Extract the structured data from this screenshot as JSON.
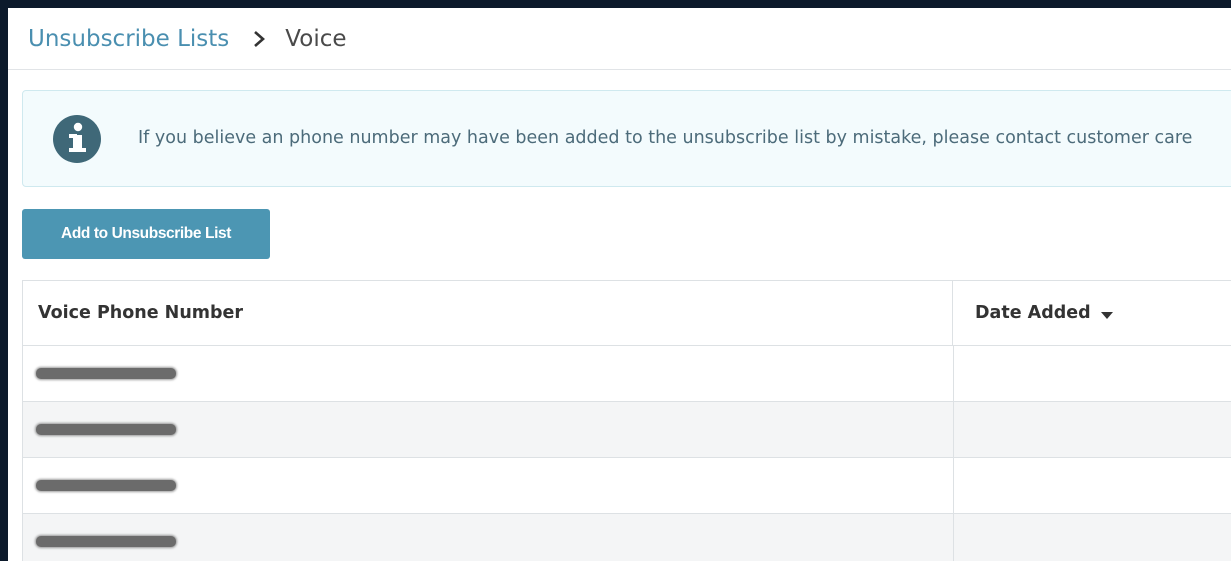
{
  "breadcrumb": {
    "parent": "Unsubscribe Lists",
    "current": "Voice"
  },
  "info": {
    "icon": "info-icon",
    "message": "If you believe an phone number may have been added to the unsubscribe list by mistake, please contact customer care"
  },
  "actions": {
    "add_label": "Add to Unsubscribe List"
  },
  "table": {
    "columns": [
      "Voice Phone Number",
      "Date Added"
    ],
    "sort": {
      "column": "Date Added",
      "direction": "descending"
    },
    "rows": [
      {
        "phone": "redacted",
        "date": ""
      },
      {
        "phone": "redacted",
        "date": ""
      },
      {
        "phone": "redacted",
        "date": ""
      },
      {
        "phone": "redacted",
        "date": ""
      }
    ]
  },
  "colors": {
    "background": "#0c1a2b",
    "link": "#4a8fb0",
    "button": "#4c96b3",
    "info_bg": "#f3fbfd",
    "info_icon": "#3f6878"
  }
}
